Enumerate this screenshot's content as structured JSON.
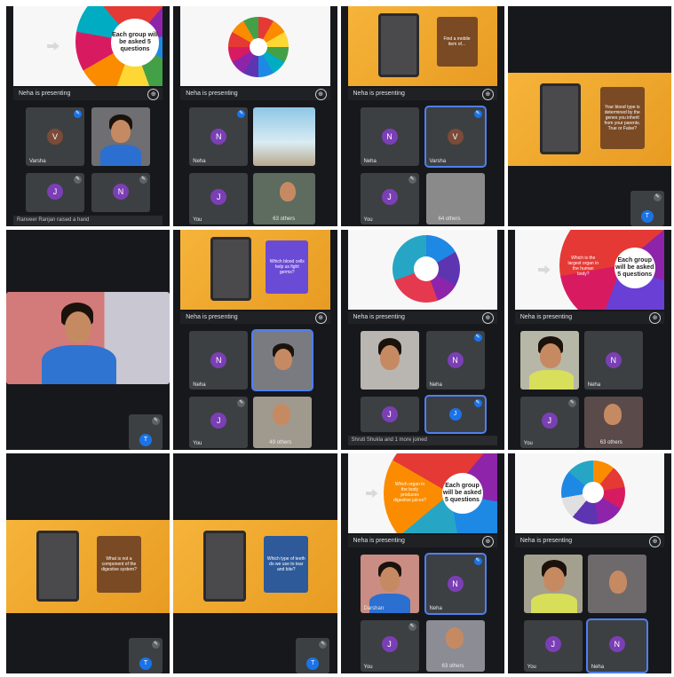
{
  "presenter": "Neha is presenting",
  "wheel_prompt": "Each group will be asked 5 questions",
  "pin_glyph": "⊕",
  "mic_glyph": "✎",
  "names": {
    "varsha": "Varsha",
    "neha": "Neha",
    "you": "You",
    "dhruv": "Darshan"
  },
  "avatars": {
    "v": "V",
    "n": "N",
    "j": "J",
    "t": "T"
  },
  "notices": {
    "hand": "Ranveer Ranjan raised a hand",
    "joined": "Shruti Shukla and 1 more joined"
  },
  "others": {
    "c1": "63 others",
    "c2": "64 others",
    "c6": "49 others",
    "c8": "63 others",
    "c11": "63 others"
  },
  "questions": {
    "c3": "Find a mobile item of...",
    "c4": "Your blood type is determined by the genes you inherit from your parents. True or False?",
    "c6": "Which blood cells help us fight germs?",
    "c8": "Which is the largest organ in the human body?",
    "c9": "What is not a component of the digestive system?",
    "c10": "Which type of teeth do we use to tear and bite?",
    "c11": "Which organ in the body produces digestive juices?"
  },
  "colors": {
    "accent": "#1a73e8",
    "orange": "#f6b43a",
    "tile": "#3c4043",
    "bg": "#17181b"
  }
}
